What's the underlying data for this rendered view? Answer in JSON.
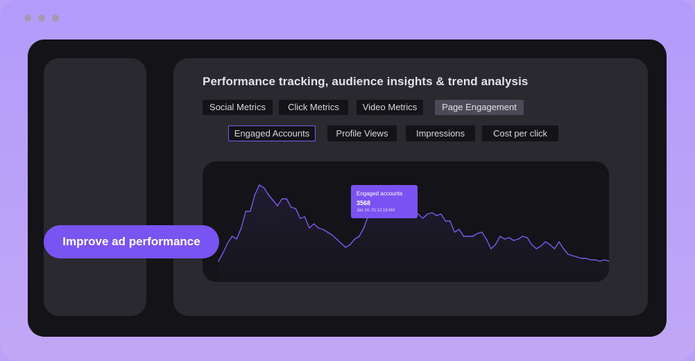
{
  "panel": {
    "title": "Performance tracking, audience insights & trend analysis"
  },
  "tabs": [
    {
      "label": "Social Metrics",
      "active": false
    },
    {
      "label": "Click Metrics",
      "active": false
    },
    {
      "label": "Video Metrics",
      "active": false
    },
    {
      "label": "Page Engagement",
      "active": true
    }
  ],
  "subtabs": [
    {
      "label": "Engaged Accounts",
      "active": true
    },
    {
      "label": "Profile Views",
      "active": false
    },
    {
      "label": "Impressions",
      "active": false
    },
    {
      "label": "Cost per click",
      "active": false
    }
  ],
  "tooltip": {
    "label": "Engaged accounts",
    "value": "3568",
    "timestamp": "Jan 14, 01:12:18 AM"
  },
  "cta": {
    "label": "Improve ad performance"
  },
  "colors": {
    "accent": "#7a53f3",
    "line": "#7b5cf0",
    "window": "#141317",
    "panel": "#2a2930"
  },
  "chart_data": {
    "type": "line",
    "series": [
      {
        "values": [
          0,
          6,
          13,
          18,
          16,
          24,
          36,
          36,
          48,
          55,
          53,
          48,
          44,
          40,
          45,
          45,
          39,
          38,
          31,
          32,
          24,
          27,
          24,
          23,
          21,
          19,
          16,
          13,
          10,
          12,
          16,
          18,
          24,
          33,
          34,
          35,
          34,
          35,
          41,
          35,
          32,
          40,
          41,
          36,
          34,
          31,
          34,
          35,
          33,
          34,
          29,
          29,
          21,
          23,
          18,
          18,
          18,
          20,
          21,
          16,
          9,
          12,
          18,
          16,
          17,
          15,
          16,
          18,
          17,
          12,
          9,
          11,
          14,
          12,
          9,
          14,
          9,
          5,
          4,
          3,
          2,
          2,
          1,
          1,
          0,
          1,
          0
        ]
      }
    ],
    "grid": false,
    "legend": "none",
    "highlighted_index": 39
  }
}
